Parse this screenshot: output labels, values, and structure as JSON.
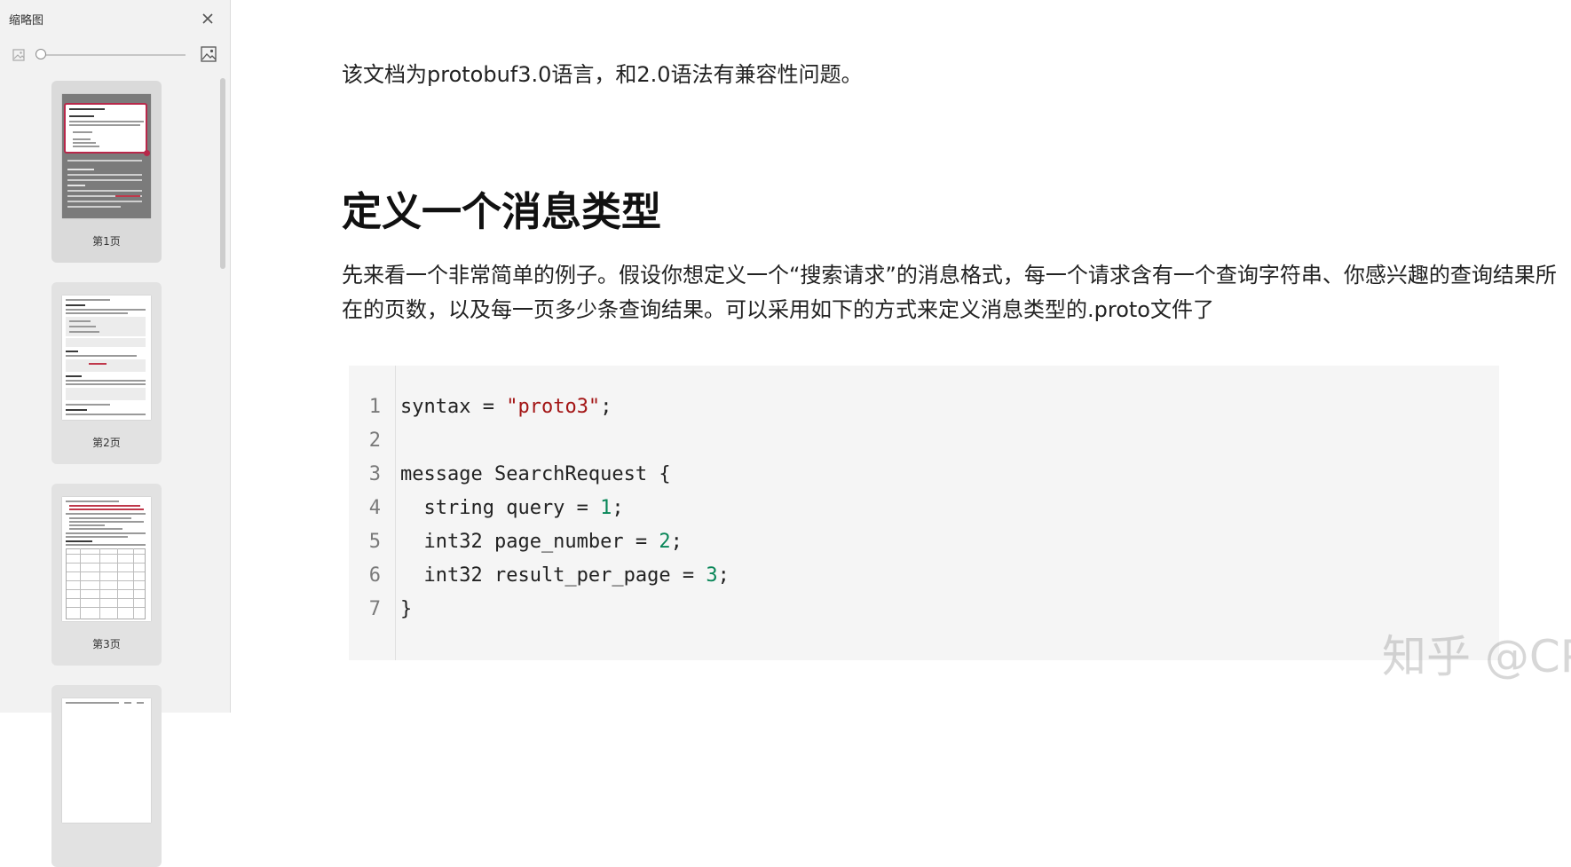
{
  "sidebar": {
    "title": "缩略图",
    "close_icon": "close-icon",
    "zoom": {
      "small_icon": "image-small-icon",
      "large_icon": "image-large-icon",
      "level": 0
    },
    "thumbnails": [
      {
        "label": "第1页",
        "active": true
      },
      {
        "label": "第2页",
        "active": false
      },
      {
        "label": "第3页",
        "active": false
      },
      {
        "label": "",
        "active": false
      }
    ]
  },
  "document": {
    "intro": "该文档为protobuf3.0语言，和2.0语法有兼容性问题。",
    "heading": "定义一个消息类型",
    "body": "先来看一个非常简单的例子。假设你想定义一个“搜索请求”的消息格式，每一个请求含有一个查询字符串、你感兴趣的查询结果所在的页数，以及每一页多少条查询结果。可以采用如下的方式来定义消息类型的.proto文件了",
    "code": [
      {
        "n": "1",
        "parts": [
          {
            "t": "syntax = ",
            "c": ""
          },
          {
            "t": "\"proto3\"",
            "c": "str"
          },
          {
            "t": ";",
            "c": ""
          }
        ]
      },
      {
        "n": "2",
        "parts": []
      },
      {
        "n": "3",
        "parts": [
          {
            "t": "message SearchRequest {",
            "c": ""
          }
        ]
      },
      {
        "n": "4",
        "parts": [
          {
            "t": "  string query = ",
            "c": ""
          },
          {
            "t": "1",
            "c": "num"
          },
          {
            "t": ";",
            "c": ""
          }
        ]
      },
      {
        "n": "5",
        "parts": [
          {
            "t": "  int32 page_number = ",
            "c": ""
          },
          {
            "t": "2",
            "c": "num"
          },
          {
            "t": ";",
            "c": ""
          }
        ]
      },
      {
        "n": "6",
        "parts": [
          {
            "t": "  int32 result_per_page = ",
            "c": ""
          },
          {
            "t": "3",
            "c": "num"
          },
          {
            "t": ";",
            "c": ""
          }
        ]
      },
      {
        "n": "7",
        "parts": [
          {
            "t": "}",
            "c": ""
          }
        ]
      }
    ]
  },
  "watermark": "知乎 @CPP加油站",
  "colors": {
    "string": "#a31515",
    "number": "#098658",
    "highlight": "#b8284a"
  }
}
